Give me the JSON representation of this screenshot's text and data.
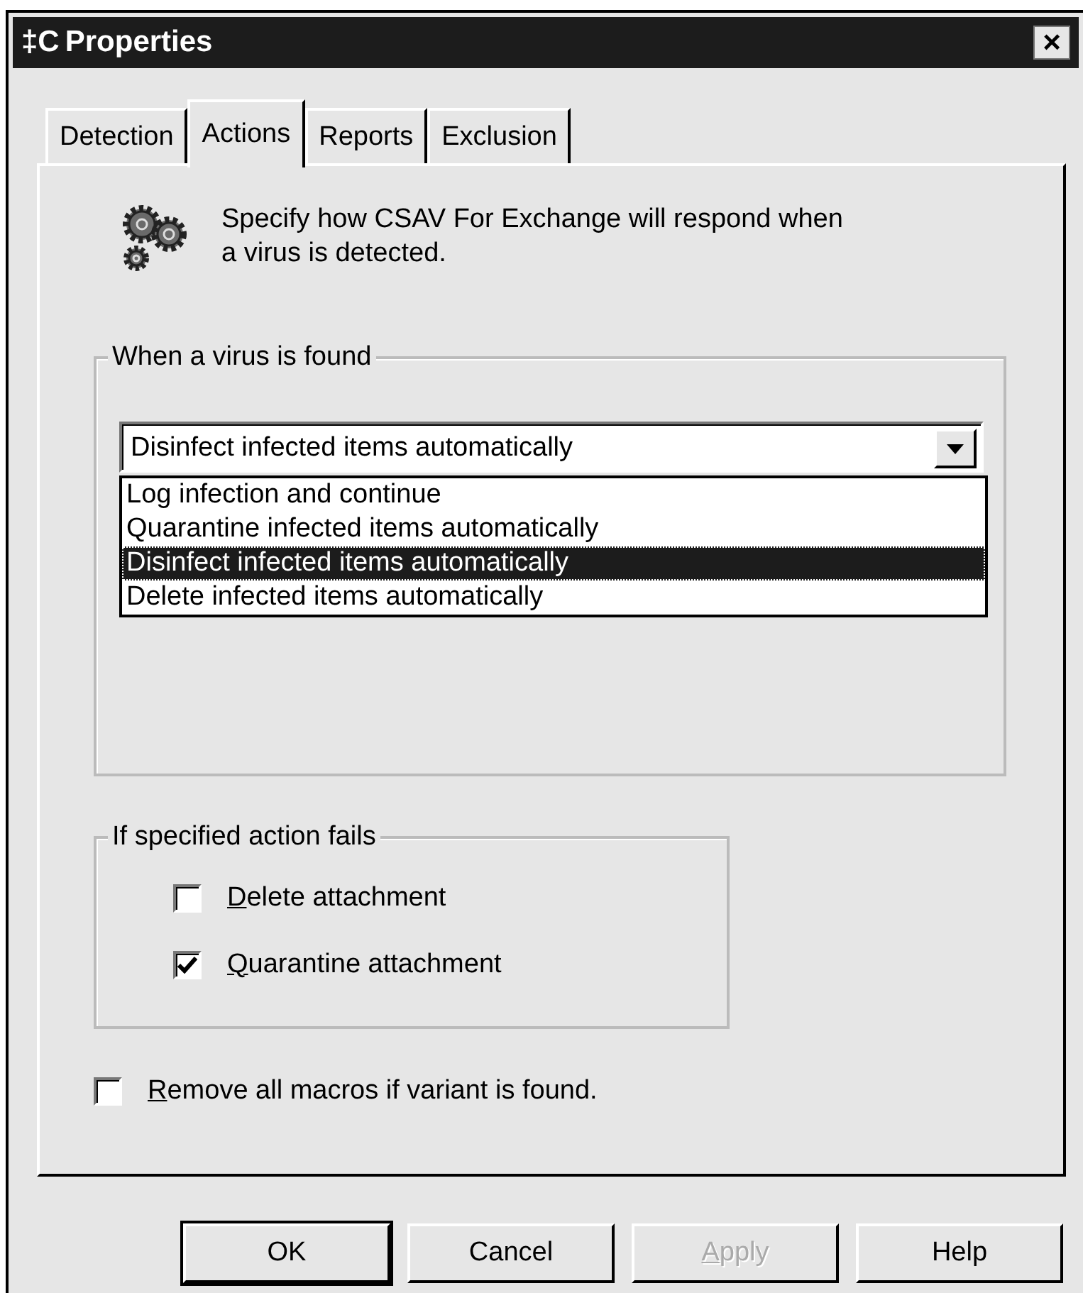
{
  "window": {
    "title": "Properties",
    "logo": "‡C",
    "close": "×"
  },
  "tabs": [
    {
      "label": "Detection",
      "selected": false
    },
    {
      "label": "Actions",
      "selected": true
    },
    {
      "label": "Reports",
      "selected": false
    },
    {
      "label": "Exclusion",
      "selected": false
    }
  ],
  "intro": "Specify how CSAV For Exchange will respond when a virus is detected.",
  "virus_group": {
    "title": "When a virus is found",
    "dropdown": {
      "value": "Disinfect infected items automatically",
      "expanded": true,
      "options": [
        {
          "label": "Log infection and continue",
          "selected": false
        },
        {
          "label": "Quarantine infected items automatically",
          "selected": false
        },
        {
          "label": "Disinfect infected items automatically",
          "selected": true
        },
        {
          "label": "Delete infected items automatically",
          "selected": false
        }
      ]
    }
  },
  "fail_group": {
    "title": "If specified action fails",
    "checkboxes": [
      {
        "label": "Delete attachment",
        "checked": false,
        "underline_first": true
      },
      {
        "label": "Quarantine attachment",
        "checked": true,
        "underline_first": true
      }
    ]
  },
  "macro_checkbox": {
    "label": "Remove all macros if variant is found.",
    "checked": false,
    "underline_first": true
  },
  "buttons": [
    {
      "label": "OK",
      "default": true,
      "disabled": false,
      "underline_first": false
    },
    {
      "label": "Cancel",
      "default": false,
      "disabled": false,
      "underline_first": false
    },
    {
      "label": "Apply",
      "default": false,
      "disabled": true,
      "underline_first": true
    },
    {
      "label": "Help",
      "default": false,
      "disabled": false,
      "underline_first": false
    }
  ]
}
